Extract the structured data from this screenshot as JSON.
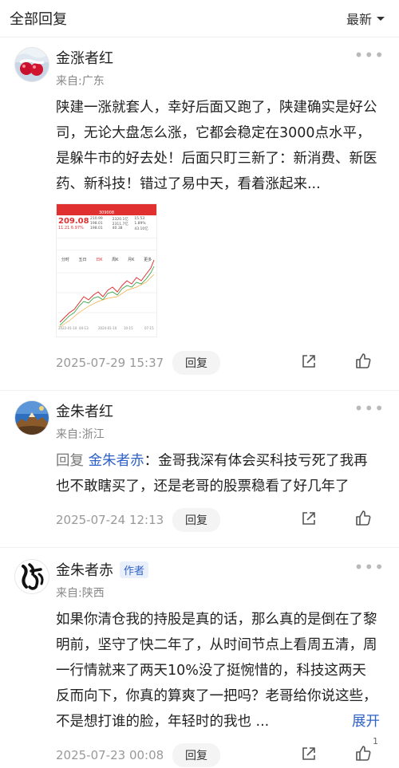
{
  "header": {
    "title": "全部回复",
    "sort_label": "最新"
  },
  "comments": [
    {
      "name": "金涨者红",
      "origin": "来自:广东",
      "text": "陕建一涨就套人，幸好后面又跑了，陕建确实是好公司，无论大盘怎么涨，它都会稳定在3000点水平，是躲牛市的好去处！后面只盯三新了：新消费、新医药、新科技！错过了易中天，看着涨起来...",
      "time": "2025-07-29 15:37",
      "reply_label": "回复",
      "screenshot": {
        "price": "209.08",
        "change": "11.21 6.97%",
        "stats": [
          "210.99",
          "198.01",
          "198.01",
          "2320.1亿",
          "2311.7亿",
          "40.38",
          "15.53",
          "1.89%",
          "43.10亿"
        ],
        "tabs": [
          "分时",
          "五日",
          "日K",
          "周K",
          "月K",
          "更多"
        ],
        "axis_dates": [
          "2022-01-10",
          "04-13",
          "2024-01-10",
          "10-15",
          "07-15"
        ],
        "ticker": "309008"
      }
    },
    {
      "name": "金朱者红",
      "origin": "来自:浙江",
      "reply_prefix": "回复",
      "reply_target": "金朱者赤",
      "text": "：金哥我深有体会买科技亏死了我再也不敢瞎买了，还是老哥的股票稳看了好几年了",
      "time": "2025-07-24 12:13",
      "reply_label": "回复"
    },
    {
      "name": "金朱者赤",
      "tag": "作者",
      "origin": "来自:陕西",
      "text": "如果你清仓我的持股是真的话，那么真的是倒在了黎明前，坚守了快二年了，从时间节点上看周五清，周一行情就来了两天10%没了挺惋惜的，科技这两天反而向下，你真的算爽了一把吗？老哥给你说这些，不是想打谁的脸，年轻时的我也 ...",
      "expand_label": "展开",
      "time": "2025-07-23 00:08",
      "reply_label": "回复",
      "like_count": "1"
    }
  ],
  "icons": [
    "chevron-down-icon",
    "more-icon",
    "share-icon",
    "thumbs-up-icon"
  ],
  "colors": {
    "accent": "#2e62c9",
    "stock_red": "#e03030"
  }
}
